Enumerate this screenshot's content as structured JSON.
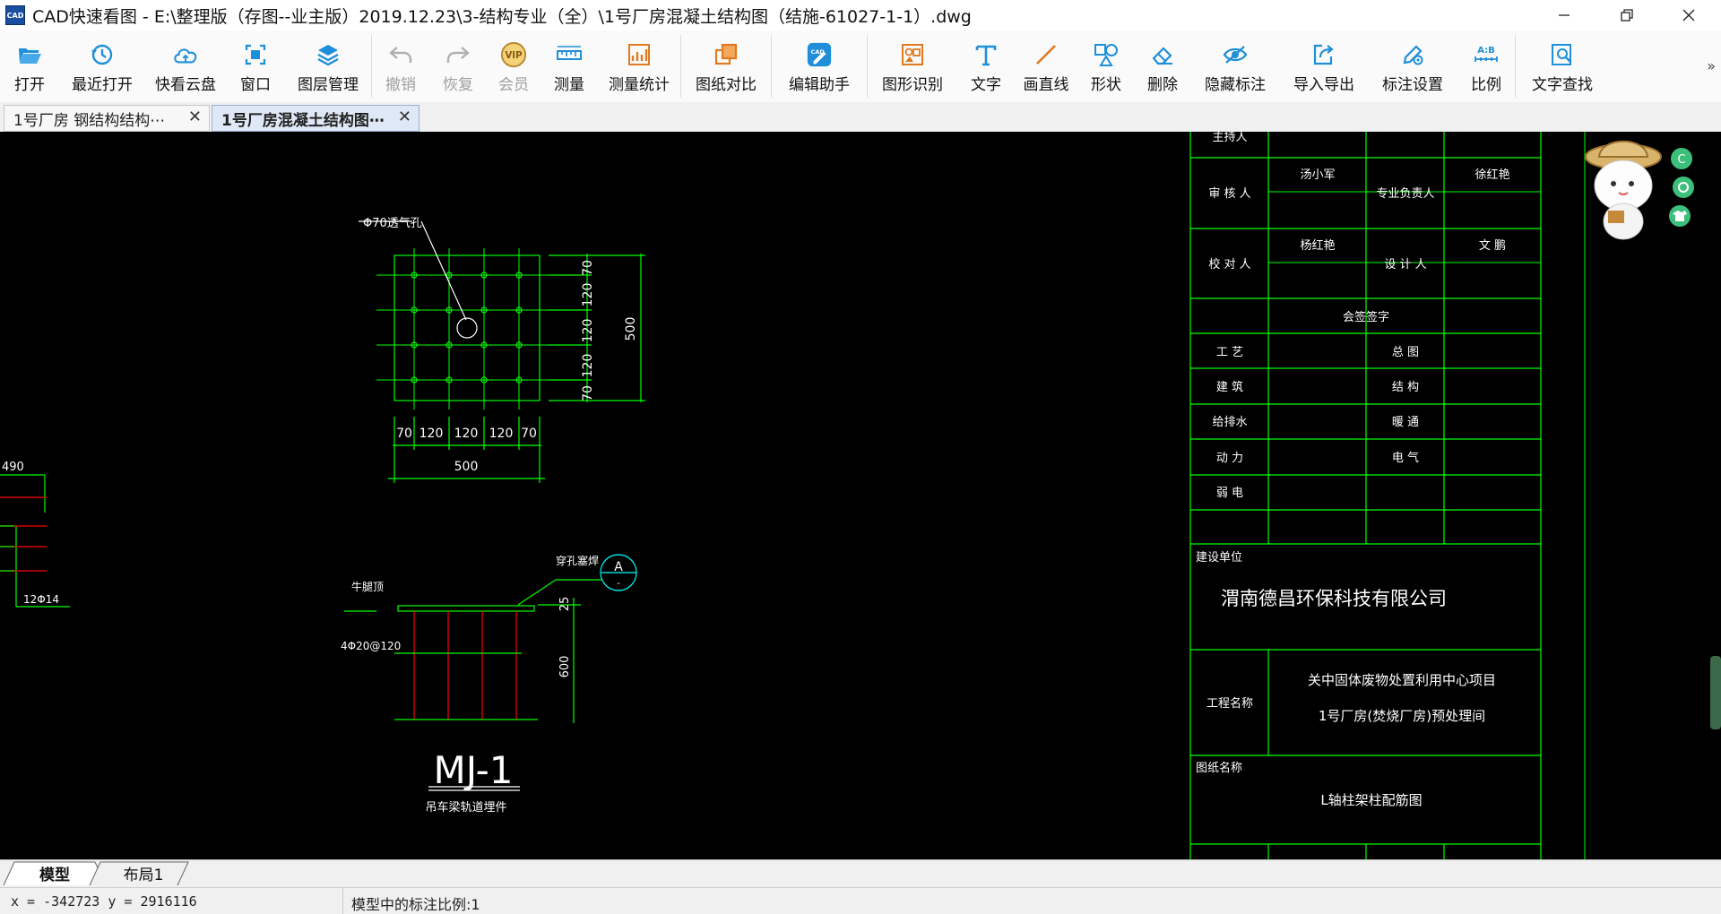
{
  "window": {
    "app_icon_text": "CAD",
    "title": "CAD快速看图 - E:\\整理版（存图--业主版）2019.12.23\\3-结构专业（全）\\1号厂房混凝土结构图（结施-61027-1-1）.dwg",
    "controls": [
      "minimize",
      "restore",
      "close"
    ]
  },
  "toolbar": [
    {
      "id": "open",
      "label": "打开",
      "icon": "folder-open-icon",
      "enabled": true
    },
    {
      "id": "recent",
      "label": "最近打开",
      "icon": "clock-icon",
      "enabled": true
    },
    {
      "id": "cloud",
      "label": "快看云盘",
      "icon": "cloud-icon",
      "enabled": true
    },
    {
      "id": "window",
      "label": "窗口",
      "icon": "window-icon",
      "enabled": true
    },
    {
      "id": "layers",
      "label": "图层管理",
      "icon": "layers-icon",
      "enabled": true
    },
    {
      "id": "undo",
      "label": "撤销",
      "icon": "undo-icon",
      "enabled": false
    },
    {
      "id": "redo",
      "label": "恢复",
      "icon": "redo-icon",
      "enabled": false
    },
    {
      "id": "vip",
      "label": "会员",
      "icon": "vip-icon",
      "enabled": false
    },
    {
      "id": "measure",
      "label": "测量",
      "icon": "ruler-icon",
      "enabled": true
    },
    {
      "id": "measure_stats",
      "label": "测量统计",
      "icon": "chart-icon",
      "enabled": true
    },
    {
      "id": "compare",
      "label": "图纸对比",
      "icon": "compare-icon",
      "enabled": true
    },
    {
      "id": "edit_assistant",
      "label": "编辑助手",
      "icon": "cad-edit-icon",
      "enabled": true
    },
    {
      "id": "shape_recognition",
      "label": "图形识别",
      "icon": "shape-recognition-icon",
      "enabled": true
    },
    {
      "id": "text",
      "label": "文字",
      "icon": "text-t-icon",
      "enabled": true
    },
    {
      "id": "draw_line",
      "label": "画直线",
      "icon": "line-icon",
      "enabled": true
    },
    {
      "id": "shape",
      "label": "形状",
      "icon": "shapes-icon",
      "enabled": true
    },
    {
      "id": "delete",
      "label": "删除",
      "icon": "eraser-icon",
      "enabled": true
    },
    {
      "id": "hide_annotation",
      "label": "隐藏标注",
      "icon": "eye-hidden-icon",
      "enabled": true
    },
    {
      "id": "import_export",
      "label": "导入导出",
      "icon": "export-icon",
      "enabled": true
    },
    {
      "id": "annotation_settings",
      "label": "标注设置",
      "icon": "pen-gear-icon",
      "enabled": true
    },
    {
      "id": "ratio",
      "label": "比例",
      "icon": "ratio-icon",
      "enabled": true
    },
    {
      "id": "find_text",
      "label": "文字查找",
      "icon": "find-text-icon",
      "enabled": true
    }
  ],
  "toolbar_more": "»",
  "doc_tabs": [
    {
      "label": "1号厂房  钢结构结构⋯",
      "active": false
    },
    {
      "label": "1号厂房混凝土结构图⋯",
      "active": true
    }
  ],
  "drawing": {
    "plate_hole_note": "Φ70透气孔",
    "plate_dims_right": [
      "70",
      "120",
      "120",
      "120",
      "70"
    ],
    "plate_total_right": "500",
    "plate_dims_bottom": [
      "70",
      "120",
      "120",
      "120",
      "70"
    ],
    "plate_total_bottom": "500",
    "left_dim_top": "490",
    "left_rebar_label": "12Φ14",
    "embed_top_label": "牛腿顶",
    "embed_hole_label": "穿孔塞焊",
    "section_marker": "A",
    "section_marker_sub": "-",
    "embed_rebar_label": "4Φ20@120",
    "embed_dim_top": "25",
    "embed_dim_main": "600",
    "embed_title": "MJ-1",
    "embed_subtitle": "吊车梁轨道埋件",
    "title_block": {
      "host": "主持人",
      "reviewer": "审 核 人",
      "reviewer_name": "汤小军",
      "specialist": "专业负责人",
      "specialist_name": "徐红艳",
      "checker": "校 对 人",
      "checker_name": "杨红艳",
      "designer": "设 计 人",
      "designer_name": "文 鹏",
      "cosign": "会签签字",
      "disciplines": [
        "工  艺",
        "总  图",
        "建  筑",
        "结  构",
        "给排水",
        "暖  通",
        "动  力",
        "电  气",
        "弱  电"
      ],
      "client_label": "建设单位",
      "client_name": "渭南德昌环保科技有限公司",
      "project_label": "工程名称",
      "project_line1": "关中固体废物处置利用中心项目",
      "project_line2": "1号厂房(焚烧厂房)预处理间",
      "drawing_label": "图纸名称",
      "drawing_name": "L轴柱架柱配筋图"
    }
  },
  "layout_tabs": [
    {
      "label": "模型",
      "active": true
    },
    {
      "label": "布局1",
      "active": false
    }
  ],
  "status": {
    "coords": "x = -342723  y = 2916116",
    "scale": "模型中的标注比例:1"
  },
  "colors": {
    "canvas_bg": "#000000",
    "cad_green": "#00ff00",
    "cad_white": "#ffffff",
    "cad_red": "#ff0000",
    "cad_cyan": "#00ffff",
    "accent": "#1e8fd8"
  }
}
